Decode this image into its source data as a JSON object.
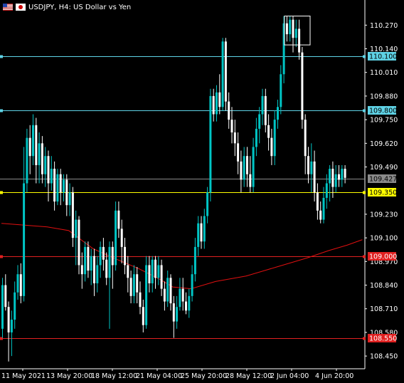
{
  "header": {
    "title": "USDJPY, H4:  US Dollar vs Yen",
    "flags": [
      "us-flag-icon",
      "jp-flag-icon"
    ]
  },
  "colors": {
    "background": "#000000",
    "bull": "#00c5c5",
    "bear": "#ffffff",
    "cyan_line": "#5fd3e6",
    "yellow_line": "#ffff00",
    "red_line": "#e02020",
    "ma": "#e01010",
    "grid_text": "#ffffff",
    "bid_line": "#8a8a8a"
  },
  "chart_data": {
    "type": "candlestick",
    "symbol": "USDJPY",
    "timeframe": "H4",
    "y_ticks": [
      "110.270",
      "110.140",
      "110.010",
      "109.880",
      "109.750",
      "109.620",
      "109.490",
      "109.230",
      "109.100",
      "108.970",
      "108.840",
      "108.710",
      "108.580",
      "108.450"
    ],
    "ylim": [
      108.38,
      110.33
    ],
    "x_labels": [
      "11 May 2021",
      "13 May 20:00",
      "18 May 12:00",
      "21 May 04:00",
      "25 May 20:00",
      "28 May 12:00",
      "2 Jun 04:00",
      "4 Jun 20:00"
    ],
    "price_labels": [
      {
        "value": 110.1,
        "text": "110.100",
        "color": "cyan"
      },
      {
        "value": 109.8,
        "text": "109.800",
        "color": "cyan"
      },
      {
        "value": 109.427,
        "text": "109.427",
        "color": "gray"
      },
      {
        "value": 109.35,
        "text": "109.350",
        "color": "yellow"
      },
      {
        "value": 109.0,
        "text": "109.000",
        "color": "red"
      },
      {
        "value": 108.55,
        "text": "108.550",
        "color": "red"
      }
    ],
    "horizontal_lines": [
      {
        "value": 110.1,
        "color": "cyan"
      },
      {
        "value": 109.8,
        "color": "cyan"
      },
      {
        "value": 109.35,
        "color": "yellow"
      },
      {
        "value": 109.0,
        "color": "red"
      },
      {
        "value": 108.55,
        "color": "red"
      }
    ],
    "bid": 109.427,
    "highlight_box": {
      "from_index": 93,
      "to_index": 100,
      "low": 110.22,
      "high": 110.32
    },
    "ma": [
      [
        0,
        109.18
      ],
      [
        15,
        109.16
      ],
      [
        22,
        109.14
      ],
      [
        30,
        109.04
      ],
      [
        38,
        108.98
      ],
      [
        45,
        108.93
      ],
      [
        52,
        108.87
      ],
      [
        56,
        108.83
      ],
      [
        62,
        108.82
      ],
      [
        70,
        108.86
      ],
      [
        80,
        108.89
      ],
      [
        90,
        108.94
      ],
      [
        100,
        108.99
      ],
      [
        107,
        109.03
      ],
      [
        113,
        109.06
      ],
      [
        118,
        109.09
      ]
    ],
    "candles": [
      [
        108.6,
        108.84,
        108.55,
        108.88
      ],
      [
        108.84,
        108.72,
        108.7,
        108.9
      ],
      [
        108.72,
        108.58,
        108.42,
        108.75
      ],
      [
        108.58,
        108.65,
        108.45,
        108.7
      ],
      [
        108.65,
        108.8,
        108.6,
        108.86
      ],
      [
        108.8,
        108.9,
        108.76,
        108.95
      ],
      [
        108.9,
        108.78,
        108.74,
        108.96
      ],
      [
        108.78,
        109.4,
        108.75,
        109.6
      ],
      [
        109.4,
        109.65,
        109.35,
        109.7
      ],
      [
        109.65,
        109.55,
        109.45,
        109.72
      ],
      [
        109.55,
        109.72,
        109.5,
        109.78
      ],
      [
        109.72,
        109.5,
        109.4,
        109.76
      ],
      [
        109.5,
        109.62,
        109.4,
        109.68
      ],
      [
        109.62,
        109.45,
        109.4,
        109.66
      ],
      [
        109.45,
        109.55,
        109.38,
        109.6
      ],
      [
        109.55,
        109.4,
        109.3,
        109.58
      ],
      [
        109.4,
        109.48,
        109.36,
        109.55
      ],
      [
        109.48,
        109.3,
        109.25,
        109.52
      ],
      [
        109.3,
        109.45,
        109.28,
        109.48
      ],
      [
        109.45,
        109.35,
        109.28,
        109.48
      ],
      [
        109.35,
        109.42,
        109.3,
        109.45
      ],
      [
        109.42,
        109.28,
        109.22,
        109.45
      ],
      [
        109.28,
        109.35,
        109.22,
        109.4
      ],
      [
        109.35,
        109.1,
        109.05,
        109.38
      ],
      [
        109.1,
        109.2,
        108.95,
        109.25
      ],
      [
        109.2,
        108.95,
        108.9,
        109.22
      ],
      [
        108.95,
        108.9,
        108.82,
        109.02
      ],
      [
        108.9,
        109.05,
        108.86,
        109.08
      ],
      [
        109.05,
        108.92,
        108.88,
        109.08
      ],
      [
        108.92,
        109.0,
        108.84,
        109.04
      ],
      [
        109.0,
        108.85,
        108.78,
        109.04
      ],
      [
        108.85,
        108.95,
        108.8,
        109.0
      ],
      [
        108.95,
        109.05,
        108.88,
        109.08
      ],
      [
        109.05,
        108.98,
        108.92,
        109.1
      ],
      [
        108.98,
        108.88,
        108.84,
        109.02
      ],
      [
        108.88,
        109.05,
        108.6,
        109.08
      ],
      [
        109.05,
        108.95,
        108.82,
        109.08
      ],
      [
        108.95,
        109.25,
        108.92,
        109.3
      ],
      [
        109.25,
        109.15,
        109.1,
        109.3
      ],
      [
        109.15,
        109.05,
        108.96,
        109.2
      ],
      [
        109.05,
        108.95,
        108.9,
        109.1
      ],
      [
        108.95,
        108.88,
        108.8,
        109.0
      ],
      [
        108.88,
        108.78,
        108.74,
        108.92
      ],
      [
        108.78,
        108.9,
        108.74,
        108.95
      ],
      [
        108.9,
        108.8,
        108.74,
        108.94
      ],
      [
        108.8,
        108.72,
        108.68,
        108.86
      ],
      [
        108.72,
        108.62,
        108.58,
        108.76
      ],
      [
        108.62,
        108.95,
        108.6,
        109.0
      ],
      [
        108.95,
        108.85,
        108.8,
        109.0
      ],
      [
        108.85,
        108.98,
        108.8,
        109.0
      ],
      [
        108.98,
        108.88,
        108.82,
        109.0
      ],
      [
        108.88,
        108.95,
        108.84,
        109.0
      ],
      [
        108.95,
        108.82,
        108.78,
        108.98
      ],
      [
        108.82,
        108.75,
        108.7,
        108.86
      ],
      [
        108.75,
        108.88,
        108.72,
        108.92
      ],
      [
        108.88,
        108.74,
        108.7,
        108.9
      ],
      [
        108.74,
        108.64,
        108.55,
        108.78
      ],
      [
        108.64,
        108.72,
        108.6,
        108.78
      ],
      [
        108.72,
        108.82,
        108.7,
        108.88
      ],
      [
        108.82,
        108.75,
        108.7,
        108.88
      ],
      [
        108.75,
        108.7,
        108.68,
        108.8
      ],
      [
        108.7,
        108.78,
        108.66,
        108.82
      ],
      [
        108.78,
        108.9,
        108.75,
        108.95
      ],
      [
        108.9,
        109.05,
        108.86,
        109.1
      ],
      [
        109.05,
        109.18,
        109.0,
        109.22
      ],
      [
        109.18,
        109.08,
        109.04,
        109.22
      ],
      [
        109.08,
        109.22,
        109.04,
        109.26
      ],
      [
        109.22,
        109.35,
        109.18,
        109.38
      ],
      [
        109.35,
        109.88,
        109.3,
        109.92
      ],
      [
        109.88,
        109.78,
        109.74,
        109.92
      ],
      [
        109.78,
        109.9,
        109.74,
        109.94
      ],
      [
        109.9,
        109.82,
        109.78,
        110.0
      ],
      [
        109.82,
        110.18,
        109.8,
        110.2
      ],
      [
        110.18,
        109.85,
        109.8,
        110.2
      ],
      [
        109.85,
        109.75,
        109.7,
        109.9
      ],
      [
        109.75,
        109.68,
        109.62,
        109.82
      ],
      [
        109.68,
        109.62,
        109.55,
        109.75
      ],
      [
        109.62,
        109.52,
        109.45,
        109.68
      ],
      [
        109.52,
        109.42,
        109.35,
        109.58
      ],
      [
        109.42,
        109.55,
        109.38,
        109.6
      ],
      [
        109.55,
        109.45,
        109.38,
        109.6
      ],
      [
        109.45,
        109.38,
        109.35,
        109.55
      ],
      [
        109.38,
        109.6,
        109.35,
        109.65
      ],
      [
        109.6,
        109.7,
        109.55,
        109.76
      ],
      [
        109.7,
        109.78,
        109.62,
        109.82
      ],
      [
        109.78,
        109.88,
        109.72,
        109.92
      ],
      [
        109.88,
        109.72,
        109.68,
        109.92
      ],
      [
        109.72,
        109.65,
        109.58,
        109.78
      ],
      [
        109.65,
        109.55,
        109.5,
        109.7
      ],
      [
        109.55,
        109.75,
        109.5,
        109.8
      ],
      [
        109.75,
        109.82,
        109.7,
        109.86
      ],
      [
        109.82,
        110.0,
        109.78,
        110.05
      ],
      [
        110.0,
        110.28,
        109.95,
        110.32
      ],
      [
        110.28,
        110.22,
        110.18,
        110.32
      ],
      [
        110.22,
        110.3,
        110.18,
        110.32
      ],
      [
        110.3,
        110.2,
        110.12,
        110.32
      ],
      [
        110.2,
        110.25,
        110.15,
        110.3
      ],
      [
        110.25,
        110.12,
        110.08,
        110.3
      ],
      [
        110.12,
        109.75,
        109.7,
        110.15
      ],
      [
        109.75,
        109.55,
        109.45,
        109.78
      ],
      [
        109.55,
        109.45,
        109.4,
        109.6
      ],
      [
        109.45,
        109.52,
        109.35,
        109.62
      ],
      [
        109.52,
        109.35,
        109.3,
        109.58
      ],
      [
        109.35,
        109.25,
        109.2,
        109.4
      ],
      [
        109.25,
        109.2,
        109.18,
        109.3
      ],
      [
        109.2,
        109.32,
        109.18,
        109.38
      ],
      [
        109.32,
        109.4,
        109.26,
        109.45
      ],
      [
        109.4,
        109.48,
        109.3,
        109.5
      ],
      [
        109.48,
        109.38,
        109.32,
        109.52
      ],
      [
        109.38,
        109.45,
        109.35,
        109.5
      ],
      [
        109.45,
        109.42,
        109.38,
        109.5
      ],
      [
        109.42,
        109.48,
        109.38,
        109.5
      ],
      [
        109.48,
        109.43,
        109.4,
        109.5
      ]
    ]
  }
}
